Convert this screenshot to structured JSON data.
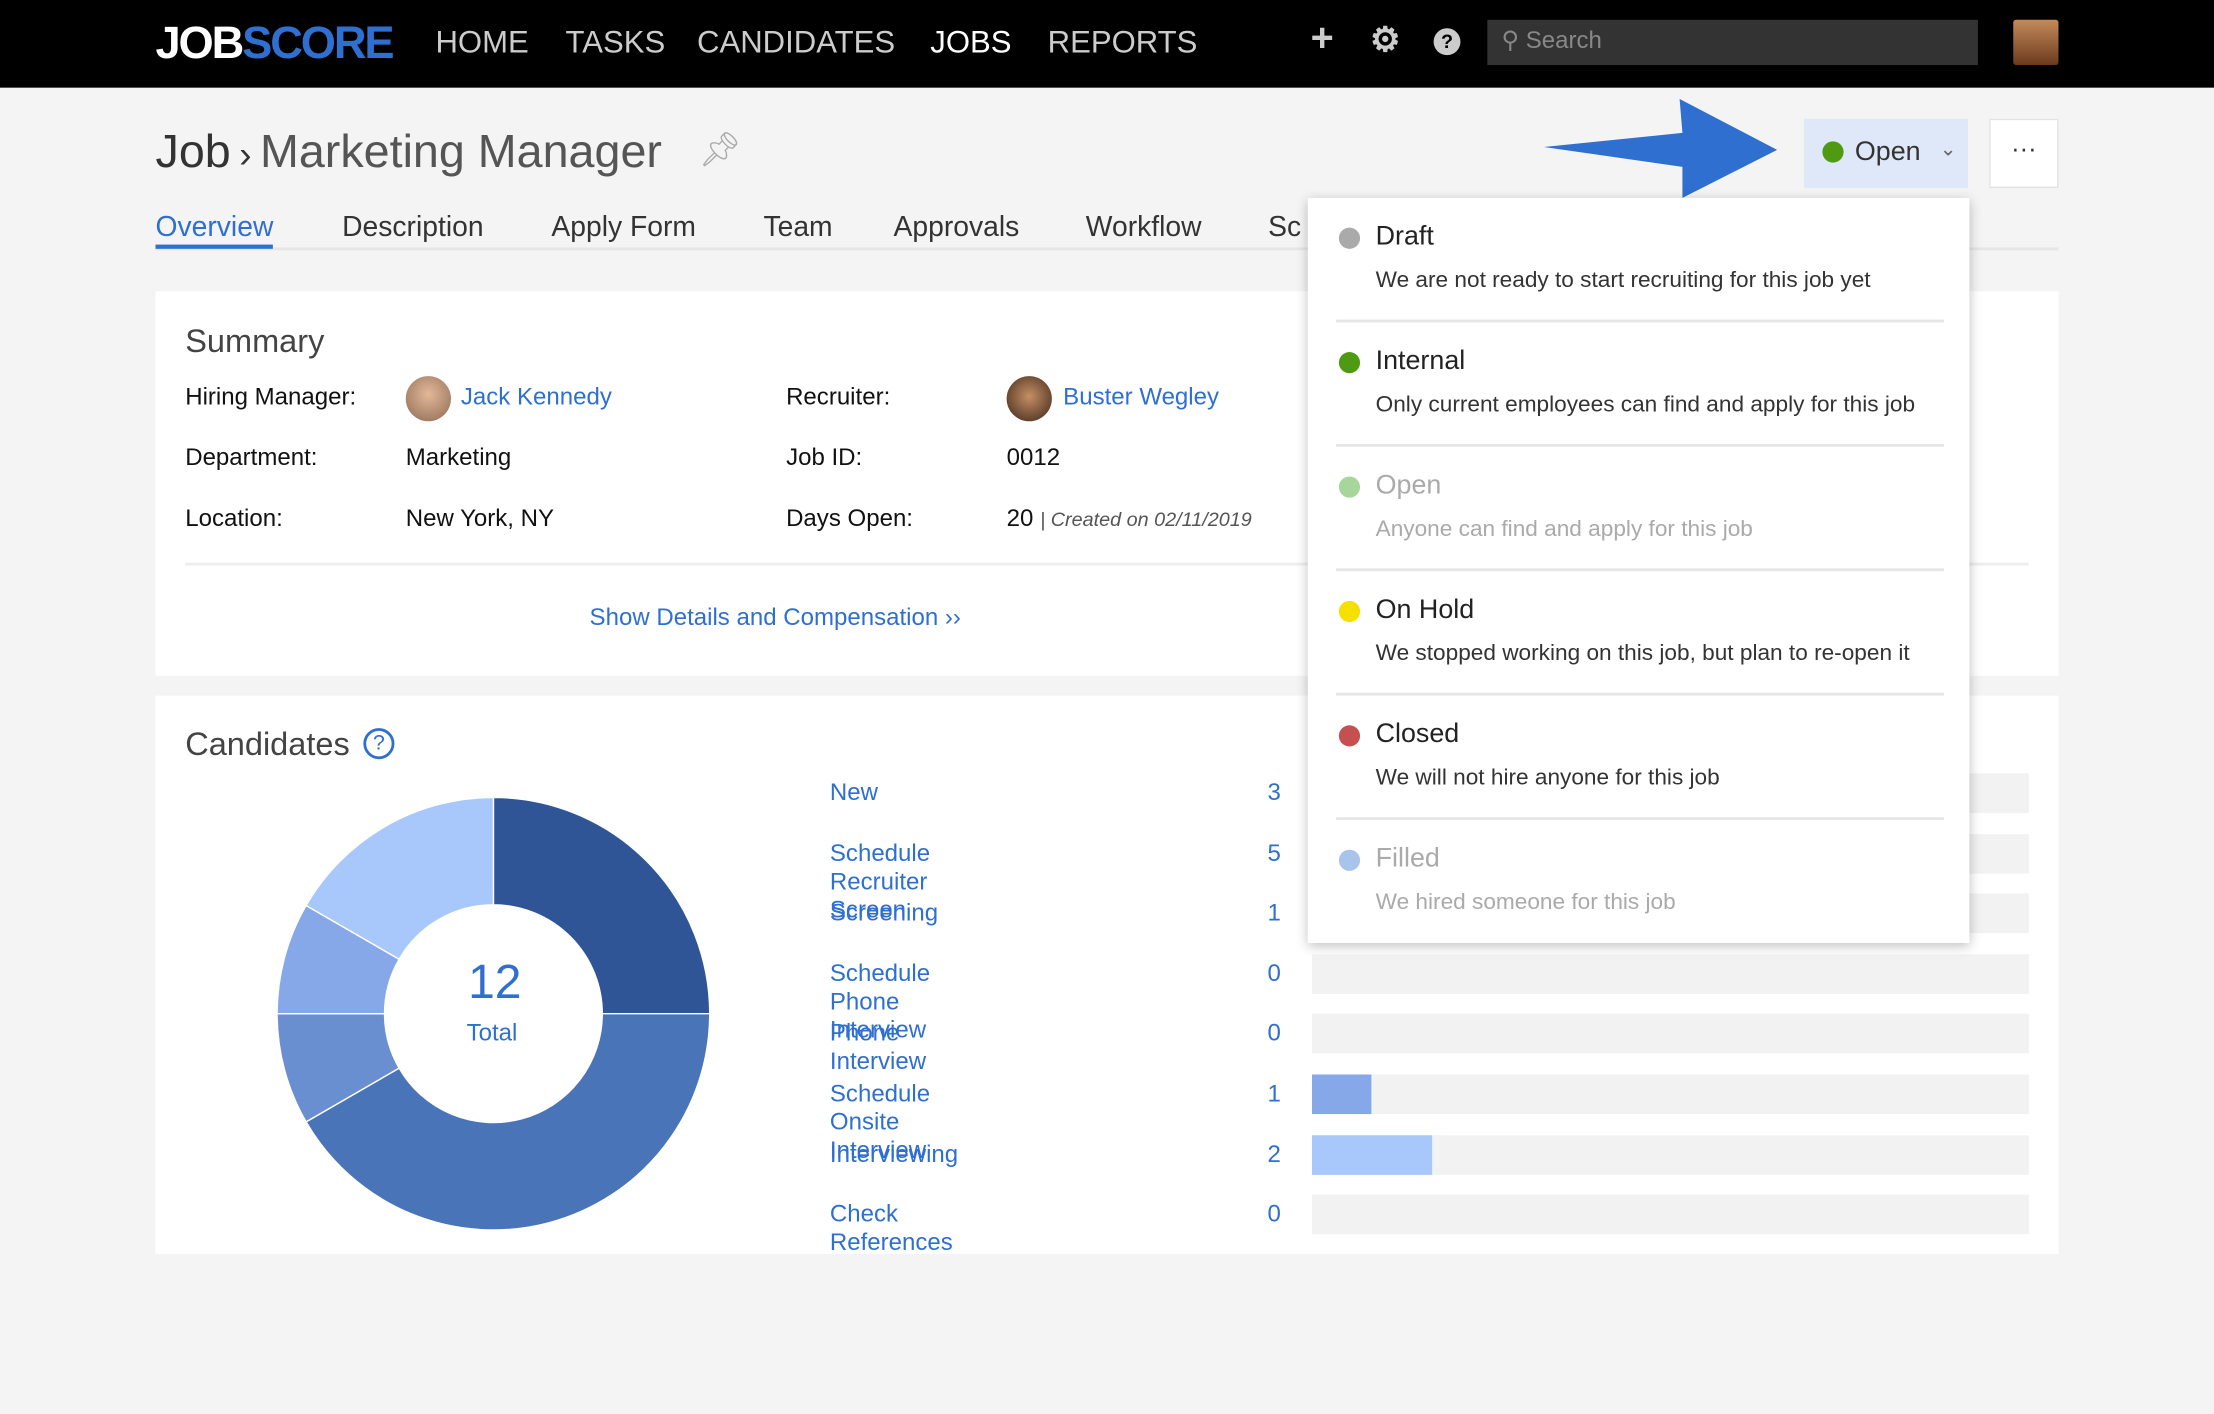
{
  "nav": {
    "logo_a": "JOB",
    "logo_b": "SCORE",
    "items": [
      "HOME",
      "TASKS",
      "CANDIDATES",
      "JOBS",
      "REPORTS"
    ],
    "active": "JOBS",
    "search_placeholder": "Search",
    "icons": [
      "plus-icon",
      "gear-icon",
      "help-icon"
    ]
  },
  "header": {
    "crumb": "Job",
    "title": "Marketing Manager",
    "status": "Open",
    "status_color": "#4f9a13",
    "more": "···"
  },
  "tabs": [
    "Overview",
    "Description",
    "Apply Form",
    "Team",
    "Approvals",
    "Workflow",
    "Sc"
  ],
  "summary": {
    "title": "Summary",
    "hiring_manager_label": "Hiring Manager:",
    "hiring_manager": "Jack Kennedy",
    "recruiter_label": "Recruiter:",
    "recruiter": "Buster Wegley",
    "department_label": "Department:",
    "department": "Marketing",
    "job_id_label": "Job ID:",
    "job_id": "0012",
    "location_label": "Location:",
    "location": "New York, NY",
    "days_open_label": "Days Open:",
    "days_open": "20",
    "created": "| Created on 02/11/2019",
    "details_link": "Show Details and Compensation ››"
  },
  "candidates": {
    "title": "Candidates",
    "total": "12",
    "total_label": "Total",
    "stages": [
      {
        "name": "New",
        "count": 3,
        "color": "#2f5597"
      },
      {
        "name": "Schedule Recruiter Screen",
        "count": 5,
        "color": "#4a74b8"
      },
      {
        "name": "Screening",
        "count": 1,
        "color": "#6a8fd0"
      },
      {
        "name": "Schedule Phone Interview",
        "count": 0,
        "color": "#6a8fd0"
      },
      {
        "name": "Phone Interview",
        "count": 0,
        "color": "#6a8fd0"
      },
      {
        "name": "Schedule Onsite Interview",
        "count": 1,
        "color": "#86a8e8"
      },
      {
        "name": "Interviewing",
        "count": 2,
        "color": "#a8c8fb"
      },
      {
        "name": "Check References",
        "count": 0,
        "color": "#a8c8fb"
      }
    ]
  },
  "status_menu": [
    {
      "name": "Draft",
      "desc": "We are not ready to start recruiting for this job yet",
      "color": "#aaaaaa",
      "dim": false
    },
    {
      "name": "Internal",
      "desc": "Only current employees can find and apply for this job",
      "color": "#4f9a13",
      "dim": false
    },
    {
      "name": "Open",
      "desc": "Anyone can find and apply for this job",
      "color": "#a8d69a",
      "dim": true
    },
    {
      "name": "On Hold",
      "desc": "We stopped working on this job, but plan to re-open it",
      "color": "#f5e000",
      "dim": false
    },
    {
      "name": "Closed",
      "desc": "We will not hire anyone for this job",
      "color": "#c65050",
      "dim": false
    },
    {
      "name": "Filled",
      "desc": "We hired someone for this job",
      "color": "#a9c4ea",
      "dim": true
    }
  ]
}
